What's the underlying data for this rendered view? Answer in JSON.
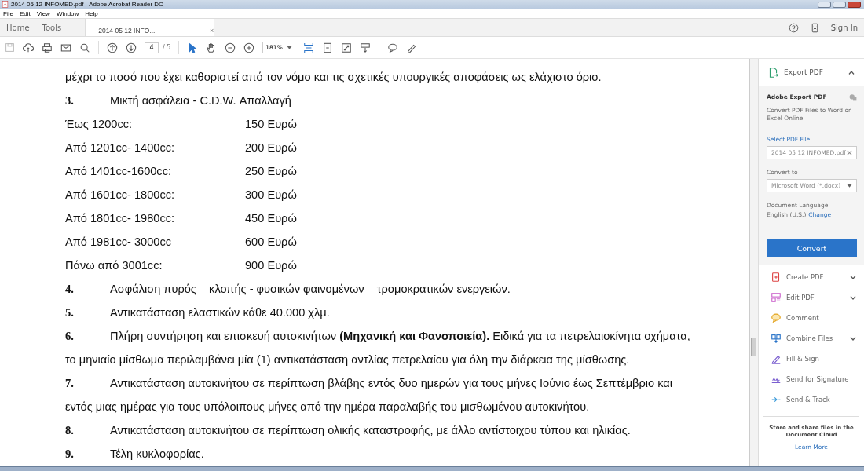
{
  "window": {
    "title": "2014 05 12 INFOMED.pdf - Adobe Acrobat Reader DC"
  },
  "menu": [
    "File",
    "Edit",
    "View",
    "Window",
    "Help"
  ],
  "tabs": [
    {
      "label": "Home",
      "selected": false,
      "kind": "nav"
    },
    {
      "label": "Tools",
      "selected": false,
      "kind": "nav"
    },
    {
      "label": "2014 05 12 INFO...",
      "selected": true,
      "kind": "doc",
      "close": "×"
    }
  ],
  "sign_in": "Sign In",
  "toolbar": {
    "page": "4",
    "page_total": "/ 5",
    "zoom": "181%"
  },
  "document": {
    "lines": [
      {
        "kind": "line",
        "text": "μέχρι το ποσό που έχει καθοριστεί από τον νόμο και τις σχετικές υπουργικές αποφάσεις ως ελάχιστο όριο."
      },
      {
        "kind": "numbered",
        "number": "3.",
        "text": "Μικτή ασφάλεια - C.D.W. Απαλλαγή"
      },
      {
        "kind": "tariff",
        "label": "Έως 1200cc:",
        "price": "150 Ευρώ"
      },
      {
        "kind": "tariff",
        "label": "Από 1201cc- 1400cc:",
        "price": "200 Ευρώ"
      },
      {
        "kind": "tariff",
        "label": "Από 1401cc-1600cc:",
        "price": "250 Ευρώ"
      },
      {
        "kind": "tariff",
        "label": "Από 1601cc- 1800cc:",
        "price": "300 Ευρώ"
      },
      {
        "kind": "tariff",
        "label": "Από 1801cc- 1980cc:",
        "price": "450 Ευρώ"
      },
      {
        "kind": "tariff",
        "label": "Από 1981cc- 3000cc",
        "price": "600 Ευρώ"
      },
      {
        "kind": "tariff",
        "label": "Πάνω από 3001cc:",
        "price": "900 Ευρώ"
      },
      {
        "kind": "numbered",
        "number": "4.",
        "text": "Ασφάλιση πυρός – κλοπής - φυσικών φαινομένων – τρομοκρατικών ενεργειών."
      },
      {
        "kind": "numbered",
        "number": "5.",
        "text": "Αντικατάσταση ελαστικών κάθε 40.000 χλμ."
      },
      {
        "kind": "numbered",
        "number": "6.",
        "segments": [
          {
            "kind": "plain",
            "text": "Πλήρη "
          },
          {
            "kind": "underline",
            "text": "συντήρηση"
          },
          {
            "kind": "plain",
            "text": " και "
          },
          {
            "kind": "underline",
            "text": "επισκευή"
          },
          {
            "kind": "plain",
            "text": " αυτοκινήτων "
          },
          {
            "kind": "bold",
            "text": "(Μηχανική και Φανοποιεία)."
          },
          {
            "kind": "plain",
            "text": " Ειδικά για τα πετρελαιοκίνητα οχήματα,"
          }
        ]
      },
      {
        "kind": "line",
        "text": "το μηνιαίο μίσθωμα περιλαμβάνει μία (1) αντικατάσταση αντλίας πετρελαίου για όλη την διάρκεια της μίσθωσης."
      },
      {
        "kind": "numbered",
        "number": "7.",
        "text": "Αντικατάσταση αυτοκινήτου σε περίπτωση βλάβης εντός δυο ημερών για τους μήνες Ιούνιο έως Σεπτέμβριο και"
      },
      {
        "kind": "line",
        "text": "εντός μιας ημέρας για τους υπόλοιπους μήνες από την ημέρα παραλαβής του μισθωμένου αυτοκινήτου."
      },
      {
        "kind": "numbered",
        "number": "8.",
        "text": "Αντικατάσταση αυτοκινήτου σε περίπτωση ολικής καταστροφής, με άλλο αντίστοιχου τύπου και ηλικίας."
      },
      {
        "kind": "numbered",
        "number": "9.",
        "text": "Τέλη κυκλοφορίας."
      }
    ]
  },
  "panel": {
    "export": {
      "title": "Export PDF",
      "expanded": true,
      "heading": "Adobe Export PDF",
      "description": "Convert PDF Files to Word or Excel Online",
      "select_label": "Select PDF File",
      "file": "2014 05 12 INFOMED.pdf",
      "convert_to_label": "Convert to",
      "format": "Microsoft Word (*.docx)",
      "language_label": "Document Language:",
      "language": "English (U.S.)",
      "change": "Change",
      "convert": "Convert"
    },
    "tools": [
      {
        "label": "Create PDF",
        "kind": "create",
        "has_menu": true
      },
      {
        "label": "Edit PDF",
        "kind": "edit",
        "has_menu": true
      },
      {
        "label": "Comment",
        "kind": "comment",
        "has_menu": false
      },
      {
        "label": "Combine Files",
        "kind": "combine",
        "has_menu": true
      },
      {
        "label": "Fill & Sign",
        "kind": "sign",
        "has_menu": false
      },
      {
        "label": "Send for Signature",
        "kind": "signature",
        "has_menu": false
      },
      {
        "label": "Send & Track",
        "kind": "track",
        "has_menu": false
      }
    ],
    "cloud_text": "Store and share files in the Document Cloud",
    "learn_more": "Learn More"
  }
}
